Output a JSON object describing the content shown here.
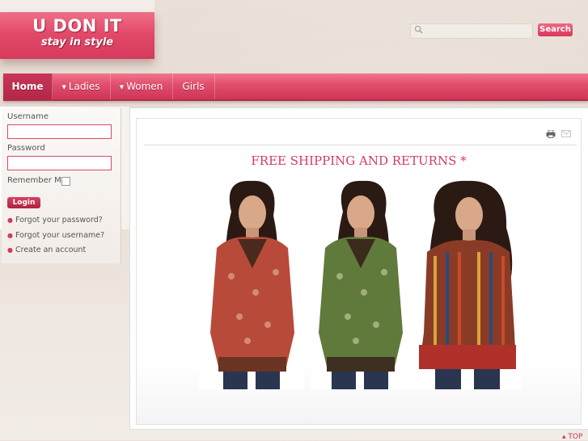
{
  "logo": {
    "title": "U DON IT",
    "tagline": "stay in style"
  },
  "search": {
    "placeholder": "",
    "button_label": "Search"
  },
  "nav": {
    "items": [
      {
        "label": "Home",
        "has_dropdown": false,
        "active": true
      },
      {
        "label": "Ladies",
        "has_dropdown": true
      },
      {
        "label": "Women",
        "has_dropdown": true
      },
      {
        "label": "Girls",
        "has_dropdown": false
      }
    ]
  },
  "login": {
    "username_label": "Username",
    "password_label": "Password",
    "remember_label": "Remember Me",
    "button_label": "Login",
    "links": [
      "Forgot your password?",
      "Forgot your username?",
      "Create an account"
    ]
  },
  "main": {
    "headline": "FREE SHIPPING AND RETURNS *",
    "icons": [
      "print-icon",
      "email-icon"
    ],
    "photos": [
      {
        "subject": "red-paisley-kurti",
        "color": "#b84a3a"
      },
      {
        "subject": "green-paisley-kurti",
        "color": "#5f7a3a"
      },
      {
        "subject": "striped-multicolor-kurti",
        "color": "#8a3b26"
      }
    ]
  },
  "footer": {
    "top_label": "TOP"
  },
  "colors": {
    "accent": "#d43b5e",
    "nav_top": "#f1768c",
    "nav_bottom": "#cf3557"
  }
}
